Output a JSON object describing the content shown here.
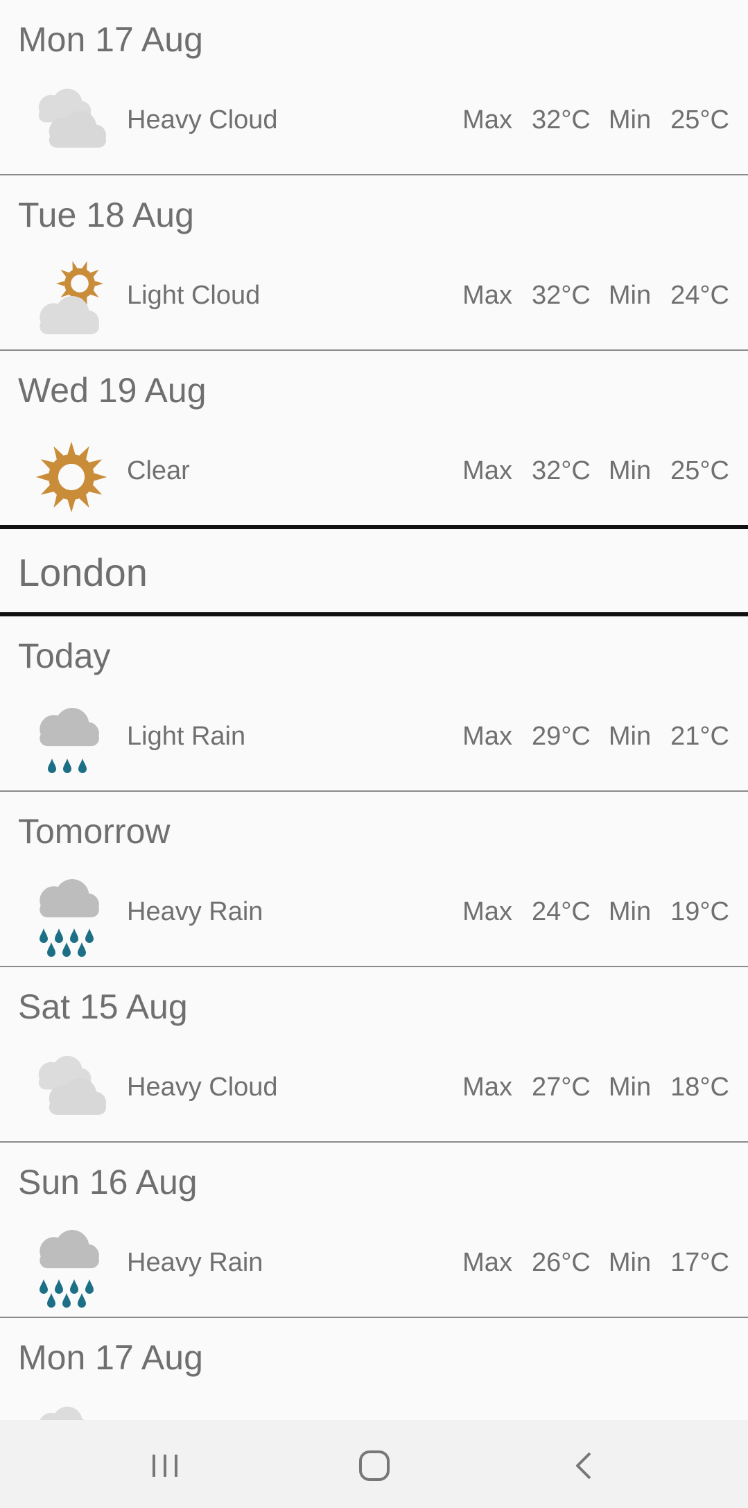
{
  "sections": [
    {
      "type": "days",
      "days": [
        {
          "day": "Mon 17 Aug",
          "icon": "heavy-cloud-icon",
          "condition": "Heavy Cloud",
          "max_label": "Max",
          "max": "32°C",
          "min_label": "Min",
          "min": "25°C"
        },
        {
          "day": "Tue 18 Aug",
          "icon": "light-cloud-icon",
          "condition": "Light Cloud",
          "max_label": "Max",
          "max": "32°C",
          "min_label": "Min",
          "min": "24°C"
        },
        {
          "day": "Wed 19 Aug",
          "icon": "clear-icon",
          "condition": "Clear",
          "max_label": "Max",
          "max": "32°C",
          "min_label": "Min",
          "min": "25°C"
        }
      ]
    },
    {
      "type": "city",
      "city": "London",
      "days": [
        {
          "day": "Today",
          "icon": "light-rain-icon",
          "condition": "Light Rain",
          "max_label": "Max",
          "max": "29°C",
          "min_label": "Min",
          "min": "21°C"
        },
        {
          "day": "Tomorrow",
          "icon": "heavy-rain-icon",
          "condition": "Heavy Rain",
          "max_label": "Max",
          "max": "24°C",
          "min_label": "Min",
          "min": "19°C"
        },
        {
          "day": "Sat 15 Aug",
          "icon": "heavy-cloud-icon",
          "condition": "Heavy Cloud",
          "max_label": "Max",
          "max": "27°C",
          "min_label": "Min",
          "min": "18°C"
        },
        {
          "day": "Sun 16 Aug",
          "icon": "heavy-rain-icon",
          "condition": "Heavy Rain",
          "max_label": "Max",
          "max": "26°C",
          "min_label": "Min",
          "min": "17°C"
        },
        {
          "day": "Mon 17 Aug",
          "icon": "heavy-cloud-icon",
          "condition": "",
          "max_label": "",
          "max": "",
          "min_label": "",
          "min": ""
        }
      ]
    }
  ],
  "colors": {
    "sun": "#c98c38",
    "cloud_light": "#dcdcdc",
    "cloud_dark": "#bdbdbd",
    "rain": "#1d6f86"
  },
  "navbar": {
    "buttons": [
      {
        "name": "recent-apps-button",
        "icon": "recent-apps-icon"
      },
      {
        "name": "home-button",
        "icon": "home-icon"
      },
      {
        "name": "back-button",
        "icon": "back-icon"
      }
    ]
  }
}
